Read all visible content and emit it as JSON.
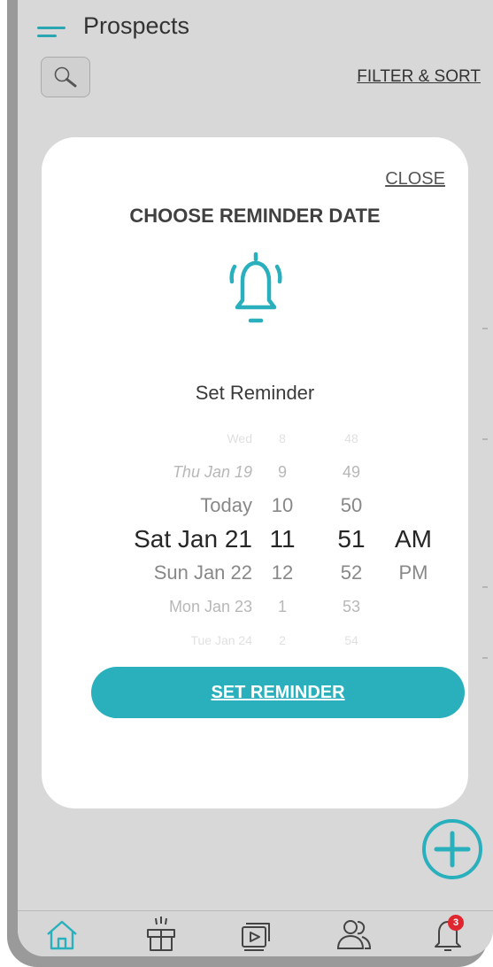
{
  "header": {
    "title": "Prospects",
    "filter_label": "FILTER & SORT"
  },
  "modal": {
    "close_label": "CLOSE",
    "title": "CHOOSE REMINDER DATE",
    "set_label": "Set Reminder",
    "button_label": "SET REMINDER",
    "picker": {
      "dates": [
        "Wed",
        "Thu Jan 19",
        "Today",
        "Sat Jan 21",
        "Sun Jan 22",
        "Mon Jan 23",
        "Tue Jan 24"
      ],
      "hours": [
        "8",
        "9",
        "10",
        "11",
        "12",
        "1",
        "2"
      ],
      "minutes": [
        "48",
        "49",
        "50",
        "51",
        "52",
        "53",
        "54"
      ],
      "ampm": [
        "AM",
        "PM"
      ],
      "selected": {
        "date": "Sat Jan 21",
        "hour": "11",
        "minute": "51",
        "ampm": "AM"
      }
    }
  },
  "bottom_nav": {
    "notification_count": "3"
  },
  "colors": {
    "accent": "#2ab0bc",
    "badge": "#e0262e"
  }
}
